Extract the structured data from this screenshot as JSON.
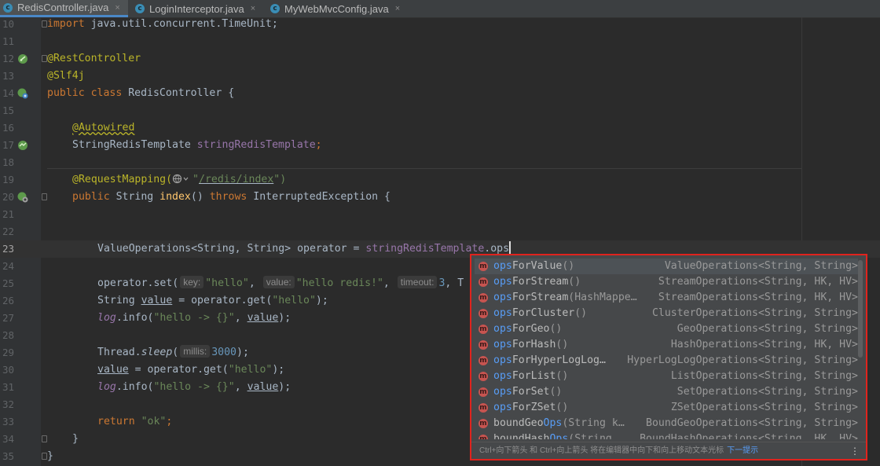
{
  "tabs": [
    {
      "label": "RedisController.java",
      "active": true
    },
    {
      "label": "LoginInterceptor.java",
      "active": false
    },
    {
      "label": "MyWebMvcConfig.java",
      "active": false
    }
  ],
  "tab_icon_letter": "c",
  "close_glyph": "×",
  "lines": {
    "n10": "10",
    "n11": "11",
    "n12": "12",
    "n13": "13",
    "n14": "14",
    "n15": "15",
    "n16": "16",
    "n17": "17",
    "n18": "18",
    "n19": "19",
    "n20": "20",
    "n21": "21",
    "n22": "22",
    "n23": "23",
    "n24": "24",
    "n25": "25",
    "n26": "26",
    "n27": "27",
    "n28": "28",
    "n29": "29",
    "n30": "30",
    "n31": "31",
    "n32": "32",
    "n33": "33",
    "n34": "34",
    "n35": "35"
  },
  "code": {
    "import_kw": "import",
    "import_path": " java.util.concurrent.TimeUnit;",
    "rest_controller": "@RestController",
    "slf4j": "@Slf4j",
    "public_class": "public class",
    "class_name": " RedisController {",
    "autowired": "@Autowired",
    "template_type": "StringRedisTemplate ",
    "template_field": "stringRedisTemplate",
    "semicolon": ";",
    "request_mapping": "@RequestMapping(",
    "mapping_open_quote": "\"",
    "mapping_path": "/redis/index",
    "mapping_close": "\")",
    "public_kw": "public",
    "string_type": " String ",
    "method_name": "index",
    "parens": "() ",
    "throws_kw": "throws",
    "exception": " InterruptedException {",
    "ops_type": "ValueOperations<String, String> operator = ",
    "ops_field": "stringRedisTemplate",
    "ops_typed": ".ops",
    "set_call": "operator.set(",
    "hint_key": "key:",
    "str_hello": "\"hello\"",
    "comma": ", ",
    "hint_value": "value:",
    "str_hello_redis": "\"hello redis!\"",
    "hint_timeout": "timeout:",
    "num_3": "3",
    "comma_t": ", T",
    "string_decl": "String ",
    "var_value": "value",
    "get_call": " = operator.get(",
    "close_semi": ");",
    "log": "log",
    "info_call": ".info(",
    "str_arrow": "\"hello -> {}\"",
    "thread": "Thread.",
    "sleep": "sleep",
    "open_paren": "(",
    "hint_millis": "millis:",
    "num_3000": "3000",
    "assign_get": " = operator.get(",
    "return_kw": "return",
    "str_ok": " \"ok\"",
    "brace_close": "}"
  },
  "completion": {
    "items": [
      {
        "hl": "ops",
        "rest": "ForValue",
        "params": "()",
        "ret": "ValueOperations<String, String>"
      },
      {
        "hl": "ops",
        "rest": "ForStream",
        "params": "()",
        "ret": "StreamOperations<String, HK, HV>"
      },
      {
        "hl": "ops",
        "rest": "ForStream",
        "params": "(HashMappe…",
        "ret": "StreamOperations<String, HK, HV>"
      },
      {
        "hl": "ops",
        "rest": "ForCluster",
        "params": "()",
        "ret": "ClusterOperations<String, String>"
      },
      {
        "hl": "ops",
        "rest": "ForGeo",
        "params": "()",
        "ret": "GeoOperations<String, String>"
      },
      {
        "hl": "ops",
        "rest": "ForHash",
        "params": "()",
        "ret": "HashOperations<String, HK, HV>"
      },
      {
        "hl": "ops",
        "rest": "ForHyperLogLog…",
        "params": "",
        "ret": "HyperLogLogOperations<String, String>"
      },
      {
        "hl": "ops",
        "rest": "ForList",
        "params": "()",
        "ret": "ListOperations<String, String>"
      },
      {
        "hl": "ops",
        "rest": "ForSet",
        "params": "()",
        "ret": "SetOperations<String, String>"
      },
      {
        "hl": "ops",
        "rest": "ForZSet",
        "params": "()",
        "ret": "ZSetOperations<String, String>"
      },
      {
        "pre": "boundGeo",
        "hl": "Ops",
        "rest": "",
        "params": "(String k…",
        "ret": "BoundGeoOperations<String, String>"
      },
      {
        "pre": "boundHash",
        "hl": "Ops",
        "rest": "",
        "params": "(String …",
        "ret": "BoundHashOperations<String, HK, HV>"
      }
    ],
    "method_icon_letter": "m",
    "footer_hint": "Ctrl+向下箭头 和 Ctrl+向上箭头 将在编辑器中向下和向上移动文本光标",
    "footer_link": "下一提示",
    "menu_glyph": "⋮"
  },
  "colors": {
    "selection_border": "#e0231d",
    "accent": "#589df6"
  }
}
